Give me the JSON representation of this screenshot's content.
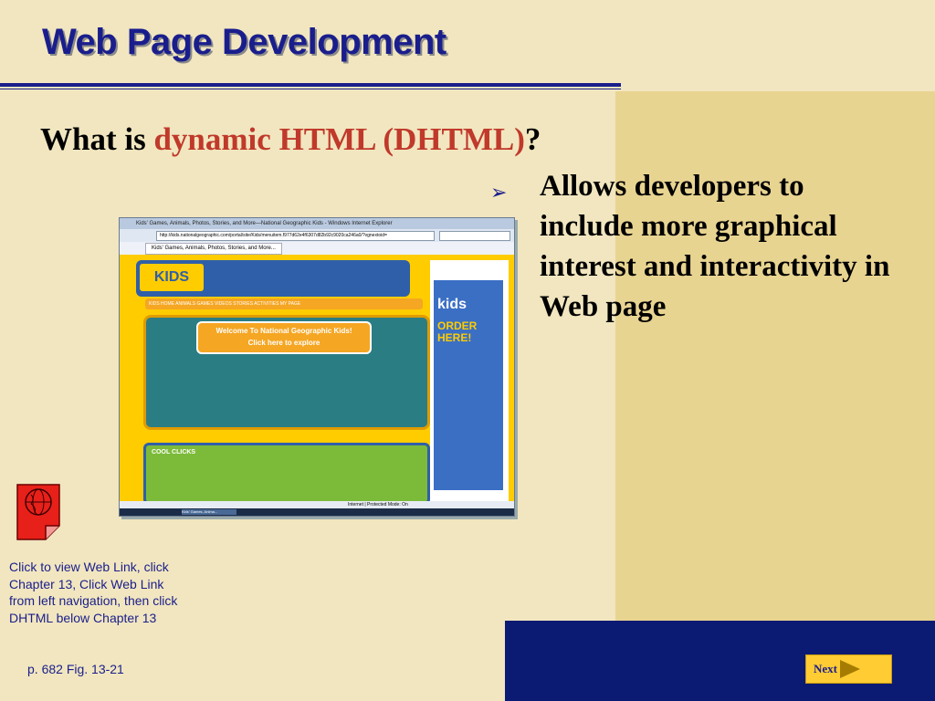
{
  "slide": {
    "title": "Web Page Development",
    "question_prefix": "What is ",
    "question_highlight": "dynamic HTML (DHTML)",
    "question_suffix": "?",
    "bullet": "Allows developers to include more graphical interest and interactivity in Web page"
  },
  "screenshot": {
    "window_title": "Kids' Games, Animals, Photos, Stories, and More—National Geographic Kids - Windows Internet Explorer",
    "address": "http://kids.nationalgeographic.com/portal/site/Kids/menuitem.f977d62e4f6307d82b92c9020ca246a0/?vgnextoid=",
    "tab_label": "Kids' Games, Animals, Photos, Stories, and More...",
    "logo": "KIDS",
    "nav": "KIDS HOME  ANIMALS  GAMES  VIDEOS  STORIES  ACTIVITIES  MY PAGE",
    "welcome_line1": "Welcome To National Geographic Kids!",
    "welcome_line2": "Click here to explore",
    "cool_clicks": "COOL CLICKS",
    "side_kids": "kids",
    "side_order": "ORDER HERE!",
    "status": "Internet | Protected Mode: On",
    "taskbar_item": "Kids' Games, Anima..."
  },
  "caption": {
    "text": "Click to view Web Link, click Chapter 13, Click Web Link from left navigation, then click DHTML below Chapter 13",
    "ref": "p. 682 Fig. 13-21"
  },
  "next_button": {
    "label": "Next"
  },
  "colors": {
    "background": "#f1e6bf",
    "panel": "#e8d491",
    "bar": "#0b1a73",
    "title": "#1a1e8c",
    "highlight": "#c0392b",
    "button": "#ffcc33"
  }
}
